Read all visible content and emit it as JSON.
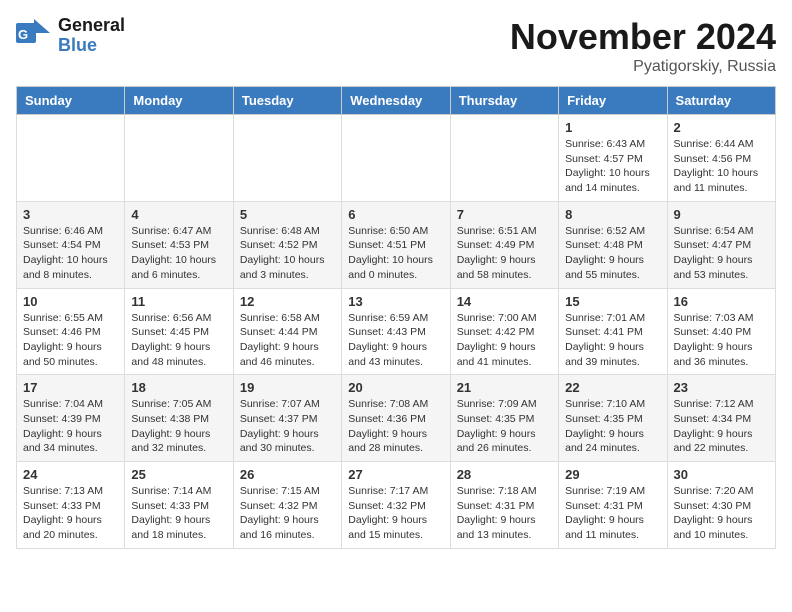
{
  "logo": {
    "line1": "General",
    "line2": "Blue"
  },
  "title": "November 2024",
  "location": "Pyatigorskiy, Russia",
  "weekdays": [
    "Sunday",
    "Monday",
    "Tuesday",
    "Wednesday",
    "Thursday",
    "Friday",
    "Saturday"
  ],
  "weeks": [
    [
      {
        "day": "",
        "info": ""
      },
      {
        "day": "",
        "info": ""
      },
      {
        "day": "",
        "info": ""
      },
      {
        "day": "",
        "info": ""
      },
      {
        "day": "",
        "info": ""
      },
      {
        "day": "1",
        "info": "Sunrise: 6:43 AM\nSunset: 4:57 PM\nDaylight: 10 hours and 14 minutes."
      },
      {
        "day": "2",
        "info": "Sunrise: 6:44 AM\nSunset: 4:56 PM\nDaylight: 10 hours and 11 minutes."
      }
    ],
    [
      {
        "day": "3",
        "info": "Sunrise: 6:46 AM\nSunset: 4:54 PM\nDaylight: 10 hours and 8 minutes."
      },
      {
        "day": "4",
        "info": "Sunrise: 6:47 AM\nSunset: 4:53 PM\nDaylight: 10 hours and 6 minutes."
      },
      {
        "day": "5",
        "info": "Sunrise: 6:48 AM\nSunset: 4:52 PM\nDaylight: 10 hours and 3 minutes."
      },
      {
        "day": "6",
        "info": "Sunrise: 6:50 AM\nSunset: 4:51 PM\nDaylight: 10 hours and 0 minutes."
      },
      {
        "day": "7",
        "info": "Sunrise: 6:51 AM\nSunset: 4:49 PM\nDaylight: 9 hours and 58 minutes."
      },
      {
        "day": "8",
        "info": "Sunrise: 6:52 AM\nSunset: 4:48 PM\nDaylight: 9 hours and 55 minutes."
      },
      {
        "day": "9",
        "info": "Sunrise: 6:54 AM\nSunset: 4:47 PM\nDaylight: 9 hours and 53 minutes."
      }
    ],
    [
      {
        "day": "10",
        "info": "Sunrise: 6:55 AM\nSunset: 4:46 PM\nDaylight: 9 hours and 50 minutes."
      },
      {
        "day": "11",
        "info": "Sunrise: 6:56 AM\nSunset: 4:45 PM\nDaylight: 9 hours and 48 minutes."
      },
      {
        "day": "12",
        "info": "Sunrise: 6:58 AM\nSunset: 4:44 PM\nDaylight: 9 hours and 46 minutes."
      },
      {
        "day": "13",
        "info": "Sunrise: 6:59 AM\nSunset: 4:43 PM\nDaylight: 9 hours and 43 minutes."
      },
      {
        "day": "14",
        "info": "Sunrise: 7:00 AM\nSunset: 4:42 PM\nDaylight: 9 hours and 41 minutes."
      },
      {
        "day": "15",
        "info": "Sunrise: 7:01 AM\nSunset: 4:41 PM\nDaylight: 9 hours and 39 minutes."
      },
      {
        "day": "16",
        "info": "Sunrise: 7:03 AM\nSunset: 4:40 PM\nDaylight: 9 hours and 36 minutes."
      }
    ],
    [
      {
        "day": "17",
        "info": "Sunrise: 7:04 AM\nSunset: 4:39 PM\nDaylight: 9 hours and 34 minutes."
      },
      {
        "day": "18",
        "info": "Sunrise: 7:05 AM\nSunset: 4:38 PM\nDaylight: 9 hours and 32 minutes."
      },
      {
        "day": "19",
        "info": "Sunrise: 7:07 AM\nSunset: 4:37 PM\nDaylight: 9 hours and 30 minutes."
      },
      {
        "day": "20",
        "info": "Sunrise: 7:08 AM\nSunset: 4:36 PM\nDaylight: 9 hours and 28 minutes."
      },
      {
        "day": "21",
        "info": "Sunrise: 7:09 AM\nSunset: 4:35 PM\nDaylight: 9 hours and 26 minutes."
      },
      {
        "day": "22",
        "info": "Sunrise: 7:10 AM\nSunset: 4:35 PM\nDaylight: 9 hours and 24 minutes."
      },
      {
        "day": "23",
        "info": "Sunrise: 7:12 AM\nSunset: 4:34 PM\nDaylight: 9 hours and 22 minutes."
      }
    ],
    [
      {
        "day": "24",
        "info": "Sunrise: 7:13 AM\nSunset: 4:33 PM\nDaylight: 9 hours and 20 minutes."
      },
      {
        "day": "25",
        "info": "Sunrise: 7:14 AM\nSunset: 4:33 PM\nDaylight: 9 hours and 18 minutes."
      },
      {
        "day": "26",
        "info": "Sunrise: 7:15 AM\nSunset: 4:32 PM\nDaylight: 9 hours and 16 minutes."
      },
      {
        "day": "27",
        "info": "Sunrise: 7:17 AM\nSunset: 4:32 PM\nDaylight: 9 hours and 15 minutes."
      },
      {
        "day": "28",
        "info": "Sunrise: 7:18 AM\nSunset: 4:31 PM\nDaylight: 9 hours and 13 minutes."
      },
      {
        "day": "29",
        "info": "Sunrise: 7:19 AM\nSunset: 4:31 PM\nDaylight: 9 hours and 11 minutes."
      },
      {
        "day": "30",
        "info": "Sunrise: 7:20 AM\nSunset: 4:30 PM\nDaylight: 9 hours and 10 minutes."
      }
    ]
  ]
}
